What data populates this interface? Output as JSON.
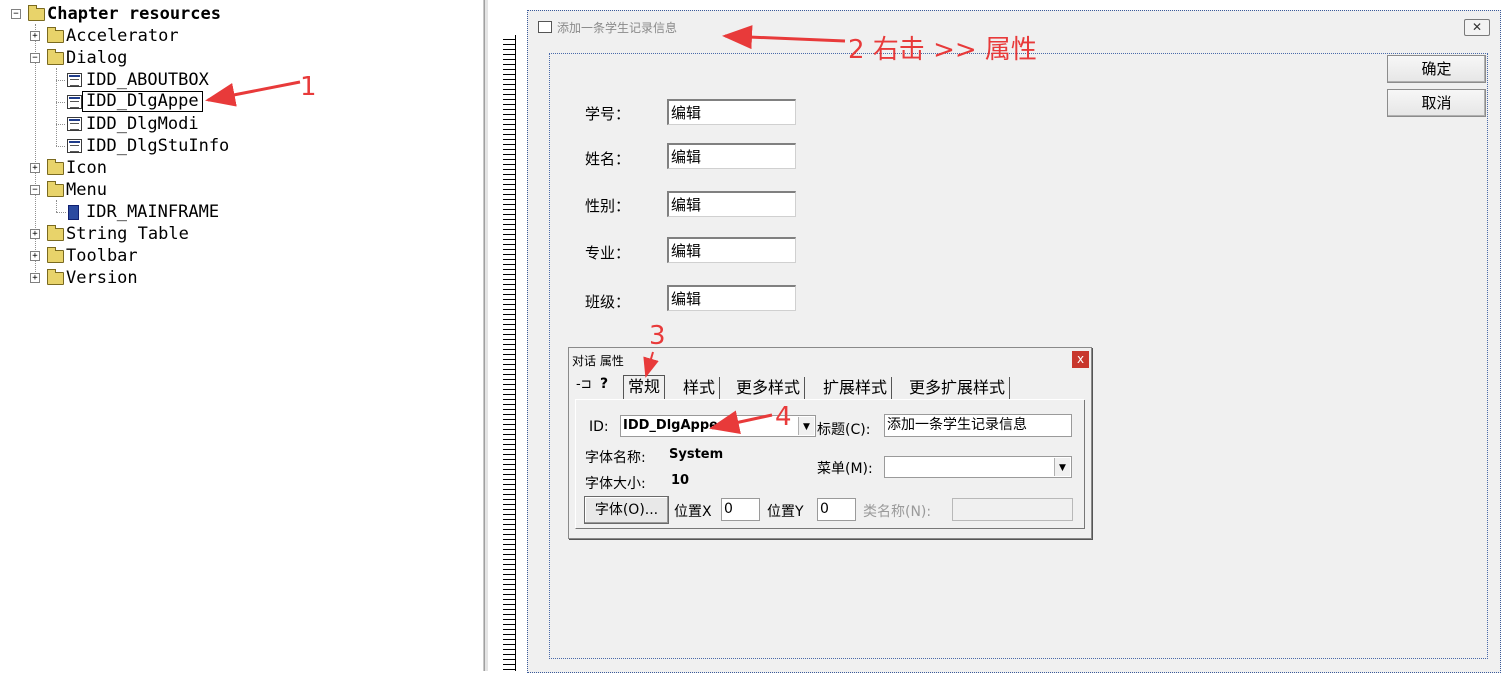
{
  "tree": {
    "root": "Chapter resources",
    "items": [
      {
        "label": "Accelerator"
      },
      {
        "label": "Dialog",
        "children": [
          "IDD_ABOUTBOX",
          "IDD_DlgAppe",
          "IDD_DlgModi",
          "IDD_DlgStuInfo"
        ]
      },
      {
        "label": "Icon"
      },
      {
        "label": "Menu",
        "children": [
          "IDR_MAINFRAME"
        ]
      },
      {
        "label": "String Table"
      },
      {
        "label": "Toolbar"
      },
      {
        "label": "Version"
      }
    ]
  },
  "dialog": {
    "title": "添加一条学生记录信息",
    "close_glyph": "✕",
    "ok_label": "确定",
    "cancel_label": "取消",
    "fields": [
      {
        "label": "学号：",
        "value": "编辑"
      },
      {
        "label": "姓名：",
        "value": "编辑"
      },
      {
        "label": "性别：",
        "value": "编辑"
      },
      {
        "label": "专业：",
        "value": "编辑"
      },
      {
        "label": "班级：",
        "value": "编辑"
      }
    ]
  },
  "properties": {
    "title": "对话 属性",
    "close_glyph": "x",
    "pin_glyph": "-⊐",
    "help_glyph": "?",
    "tabs": [
      "常规",
      "样式",
      "更多样式",
      "扩展样式",
      "更多扩展样式"
    ],
    "active_tab": "常规",
    "id_label": "ID:",
    "id_value": "IDD_DlgAppe",
    "caption_label": "标题(C):",
    "caption_value": "添加一条学生记录信息",
    "font_name_label": "字体名称:",
    "font_name_value": "System",
    "font_size_label": "字体大小:",
    "font_size_value": "10",
    "menu_label": "菜单(M):",
    "menu_value": "",
    "font_button": "字体(O)...",
    "pos_x_label": "位置X",
    "pos_x_value": "0",
    "pos_y_label": "位置Y",
    "pos_y_value": "0",
    "class_label": "类名称(N):",
    "class_value": ""
  },
  "annotations": {
    "a1": "1",
    "a2": "2 右击 >> 属性",
    "a3": "3",
    "a4": "4"
  },
  "colors": {
    "annotation": "#e83a3a",
    "folder": "#e8d36a",
    "close_button": "#c8372d"
  }
}
